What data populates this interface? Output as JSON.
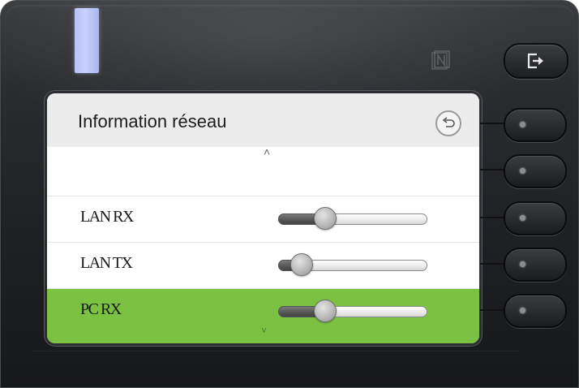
{
  "screen": {
    "title": "Information réseau",
    "back_icon": "back-arrow-icon",
    "scroll_up_glyph": "˄",
    "scroll_down_glyph": "˅",
    "rows": [
      {
        "label": "",
        "kind": "empty"
      },
      {
        "label": "LAN RX",
        "level_fraction": 0.24,
        "selected": false
      },
      {
        "label": "LAN TX",
        "level_fraction": 0.08,
        "selected": false
      },
      {
        "label": "PC RX",
        "level_fraction": 0.24,
        "selected": true
      }
    ]
  },
  "device": {
    "exit_icon": "exit-icon",
    "nfc_icon": "nfc-icon",
    "softkeys": [
      "softkey-1",
      "softkey-2",
      "softkey-3",
      "softkey-4",
      "softkey-5"
    ]
  },
  "colors": {
    "selected_row": "#7cc242",
    "header_bg": "#ececec",
    "led": "#c1cbf8"
  }
}
